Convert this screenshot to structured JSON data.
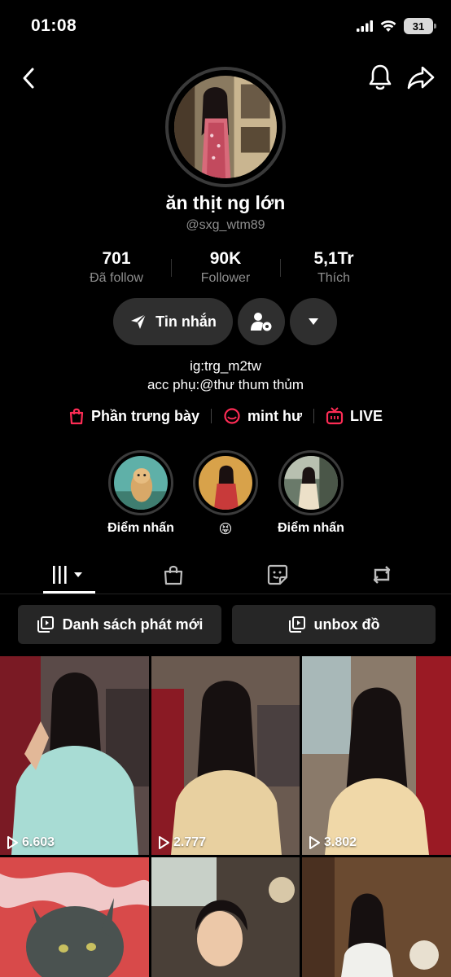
{
  "status_bar": {
    "time": "01:08",
    "battery": "31"
  },
  "profile": {
    "display_name": "ăn thịt ng lớn",
    "username": "@sxg_wtm89"
  },
  "stats": [
    {
      "value": "701",
      "label": "Đã follow"
    },
    {
      "value": "90K",
      "label": "Follower"
    },
    {
      "value": "5,1Tr",
      "label": "Thích"
    }
  ],
  "actions": {
    "message_label": "Tin nhắn"
  },
  "bio": {
    "line1": "ig:trg_m2tw",
    "line2": "acc phụ:@thư thum thủm"
  },
  "links": [
    {
      "label": "Phần trưng bày",
      "icon": "shopping-bag-icon"
    },
    {
      "label": "mint hư",
      "icon": "chat-bubble-icon"
    },
    {
      "label": "LIVE",
      "icon": "live-tv-icon"
    }
  ],
  "highlights": [
    {
      "label": "Điểm nhấn"
    },
    {
      "label": "😝"
    },
    {
      "label": "Điểm nhấn"
    }
  ],
  "tabs": [
    {
      "name": "videos",
      "icon": "grid-bars-icon",
      "active": true
    },
    {
      "name": "shop",
      "icon": "shopping-bag-icon",
      "active": false
    },
    {
      "name": "stickers",
      "icon": "sticker-icon",
      "active": false
    },
    {
      "name": "reposts",
      "icon": "repost-icon",
      "active": false
    }
  ],
  "playlists": [
    {
      "label": "Danh sách phát mới"
    },
    {
      "label": "unbox đồ"
    }
  ],
  "videos": [
    {
      "views": "6.603"
    },
    {
      "views": "2.777"
    },
    {
      "views": "3.802"
    },
    {
      "views": ""
    },
    {
      "views": ""
    },
    {
      "views": ""
    }
  ],
  "colors": {
    "accent_red": "#fe2c55",
    "button_bg": "#2f2f2f",
    "muted_text": "#8e8e8e"
  }
}
